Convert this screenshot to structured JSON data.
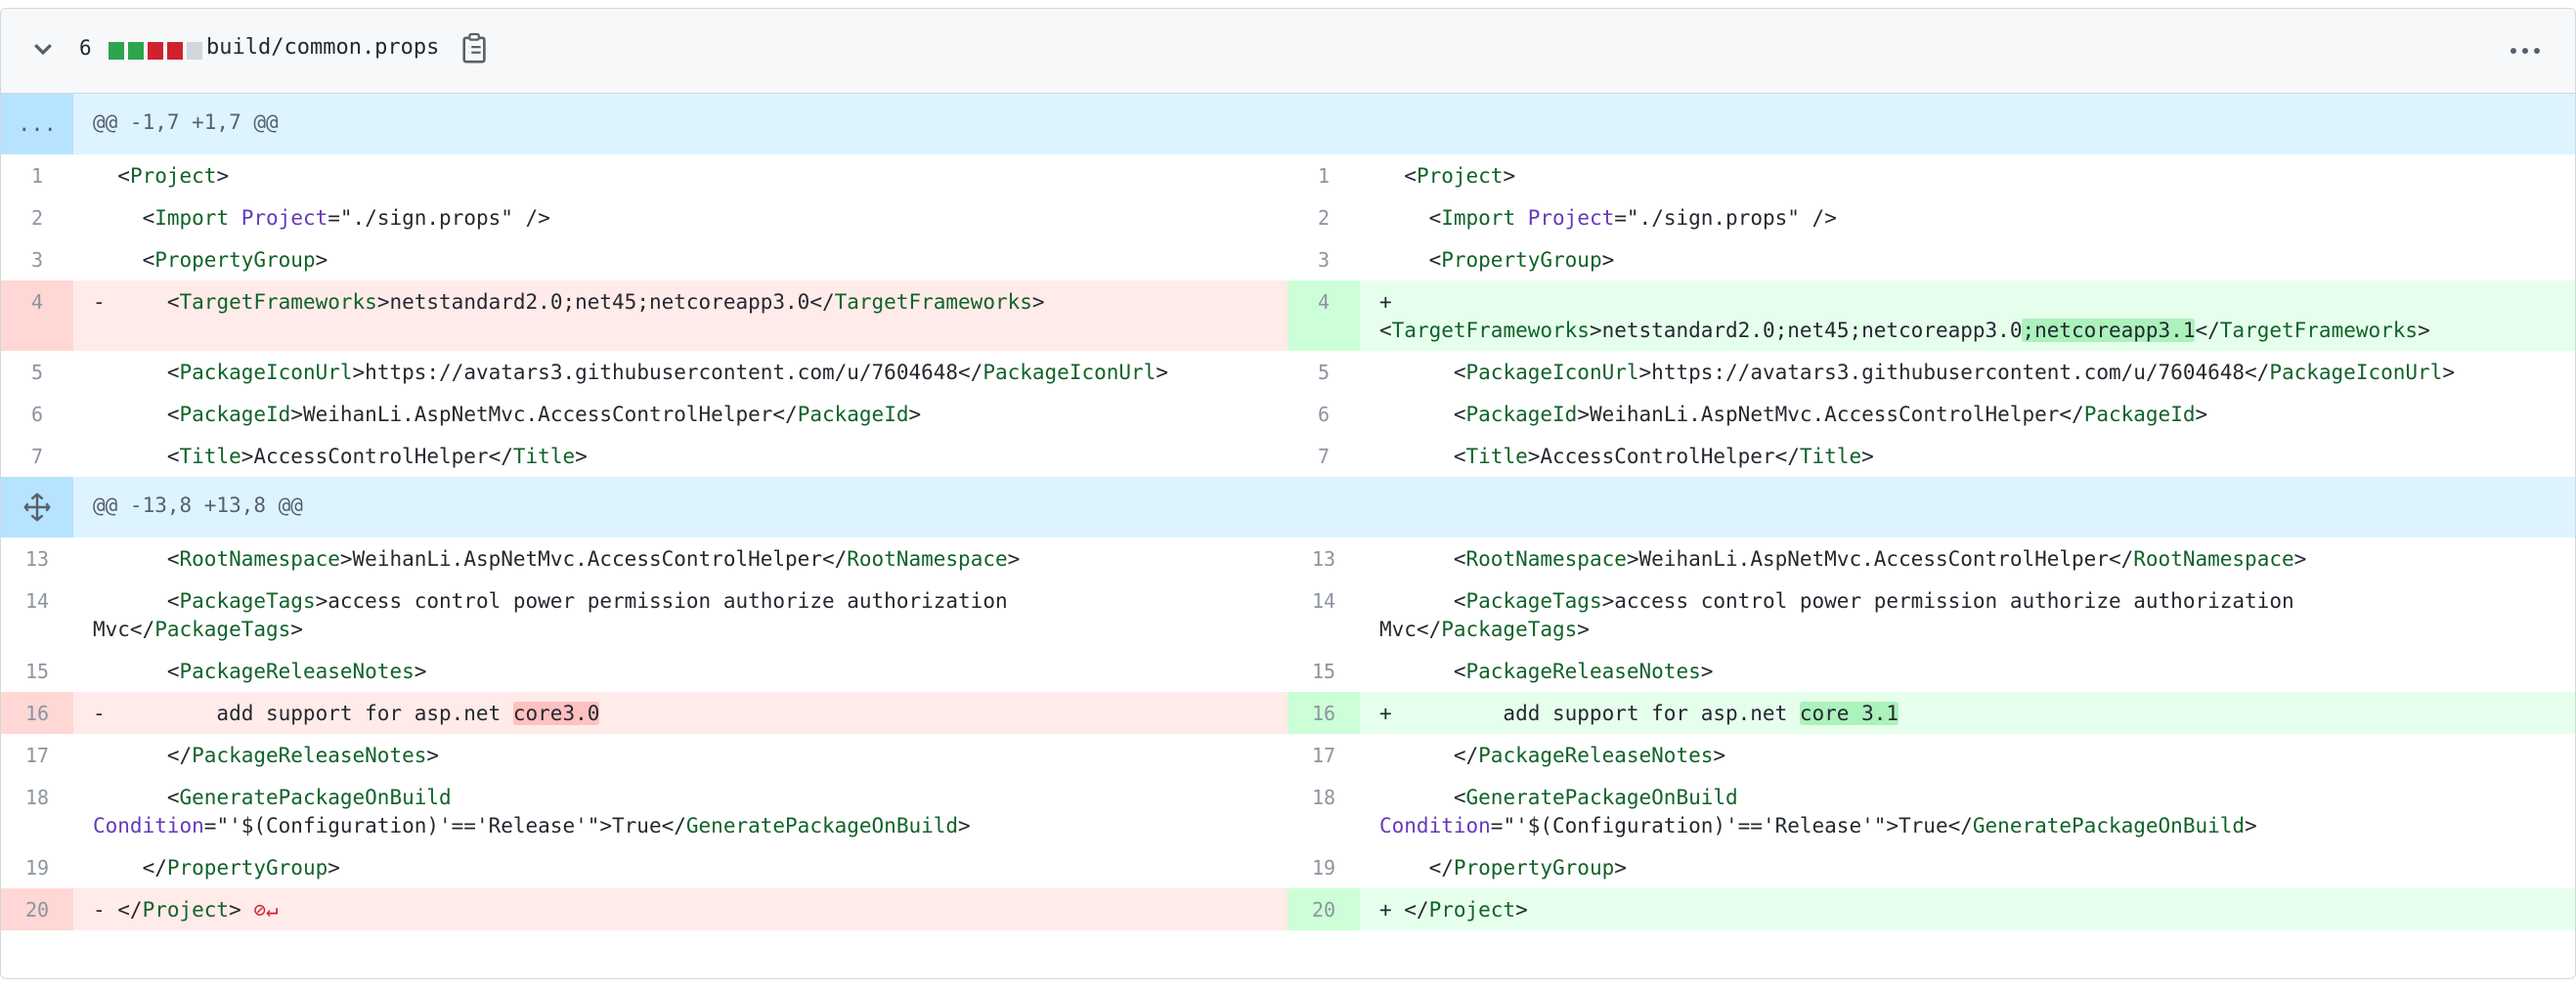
{
  "file": {
    "change_count": "6",
    "diffstat": [
      "#2da44e",
      "#2da44e",
      "#cf222e",
      "#cf222e",
      "#d0d7de"
    ],
    "path": "build/common.props",
    "icons": {
      "collapse": "chevron-down-icon",
      "copy": "clipboard-icon",
      "more": "kebab-horizontal-icon"
    }
  },
  "hunks": [
    {
      "header": "@@ -1,7 +1,7 @@",
      "expander": "...",
      "rows": [
        {
          "ln": "1",
          "rn": "1",
          "lt": "  <Project>",
          "rt": "  <Project>"
        },
        {
          "ln": "2",
          "rn": "2",
          "lt": "    <Import Project=\"./sign.props\" />",
          "rt": "    <Import Project=\"./sign.props\" />"
        },
        {
          "ln": "3",
          "rn": "3",
          "lt": "    <PropertyGroup>",
          "rt": "    <PropertyGroup>"
        },
        {
          "ln": "4",
          "rn": "4",
          "lt": "-     <TargetFrameworks>netstandard2.0;net45;netcoreapp3.0</TargetFrameworks>",
          "rt": "+\n<TargetFrameworks>netstandard2.0;net45;netcoreapp3.0;netcoreapp3.1</TargetFrameworks>",
          "change": true
        },
        {
          "ln": "5",
          "rn": "5",
          "lt": "      <PackageIconUrl>https://avatars3.githubusercontent.com/u/7604648</PackageIconUrl>",
          "rt": "      <PackageIconUrl>https://avatars3.githubusercontent.com/u/7604648</PackageIconUrl>"
        },
        {
          "ln": "6",
          "rn": "6",
          "lt": "      <PackageId>WeihanLi.AspNetMvc.AccessControlHelper</PackageId>",
          "rt": "      <PackageId>WeihanLi.AspNetMvc.AccessControlHelper</PackageId>"
        },
        {
          "ln": "7",
          "rn": "7",
          "lt": "      <Title>AccessControlHelper</Title>",
          "rt": "      <Title>AccessControlHelper</Title>"
        }
      ]
    },
    {
      "header": "@@ -13,8 +13,8 @@",
      "expander": "expand-icon",
      "rows": [
        {
          "ln": "13",
          "rn": "13",
          "lt": "      <RootNamespace>WeihanLi.AspNetMvc.AccessControlHelper</RootNamespace>",
          "rt": "      <RootNamespace>WeihanLi.AspNetMvc.AccessControlHelper</RootNamespace>"
        },
        {
          "ln": "14",
          "rn": "14",
          "lt": "      <PackageTags>access control power permission authorize authorization\nMvc</PackageTags>",
          "rt": "      <PackageTags>access control power permission authorize authorization\nMvc</PackageTags>"
        },
        {
          "ln": "15",
          "rn": "15",
          "lt": "      <PackageReleaseNotes>",
          "rt": "      <PackageReleaseNotes>"
        },
        {
          "ln": "16",
          "rn": "16",
          "lt": "-         add support for asp.net core3.0",
          "rt": "+         add support for asp.net core 3.1",
          "change": true
        },
        {
          "ln": "17",
          "rn": "17",
          "lt": "      </PackageReleaseNotes>",
          "rt": "      </PackageReleaseNotes>"
        },
        {
          "ln": "18",
          "rn": "18",
          "lt": "      <GeneratePackageOnBuild\nCondition=\"'$(Configuration)'=='Release'\">True</GeneratePackageOnBuild>",
          "rt": "      <GeneratePackageOnBuild\nCondition=\"'$(Configuration)'=='Release'\">True</GeneratePackageOnBuild>"
        },
        {
          "ln": "19",
          "rn": "19",
          "lt": "    </PropertyGroup>",
          "rt": "    </PropertyGroup>"
        },
        {
          "ln": "20",
          "rn": "20",
          "lt": "- </Project>",
          "rt": "+ </Project>",
          "change": true,
          "no_newline_icon": "no-newline-icon"
        }
      ]
    }
  ]
}
